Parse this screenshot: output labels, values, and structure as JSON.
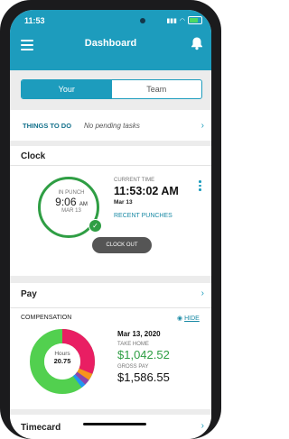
{
  "status_bar": {
    "time": "11:53"
  },
  "header": {
    "title": "Dashboard"
  },
  "tabs": [
    {
      "label": "Your",
      "active": true
    },
    {
      "label": "Team",
      "active": false
    }
  ],
  "todo": {
    "label": "THINGS TO DO",
    "text": "No pending tasks"
  },
  "clock": {
    "title": "Clock",
    "in_punch_label": "IN PUNCH",
    "in_punch_time": "9:06",
    "in_punch_ampm": "AM",
    "in_punch_date": "MAR 13",
    "current_time_label": "CURRENT TIME",
    "current_time": "11:53:02 AM",
    "current_date": "Mar 13",
    "recent_punches": "RECENT PUNCHES",
    "clock_out": "CLOCK OUT"
  },
  "pay": {
    "title": "Pay",
    "compensation_label": "COMPENSATION",
    "hide_label": "HIDE",
    "date": "Mar 13, 2020",
    "take_home_label": "TAKE HOME",
    "take_home_value": "$1,042.52",
    "gross_pay_label": "GROSS PAY",
    "gross_pay_value": "$1,586.55",
    "hours_label": "Hours",
    "hours_value": "20.75",
    "colors": {
      "green": "#52d04f",
      "pink": "#e91e63",
      "orange": "#f7941d",
      "purple": "#8e44ad",
      "blue": "#2196f3"
    }
  },
  "timecard": {
    "title": "Timecard"
  }
}
